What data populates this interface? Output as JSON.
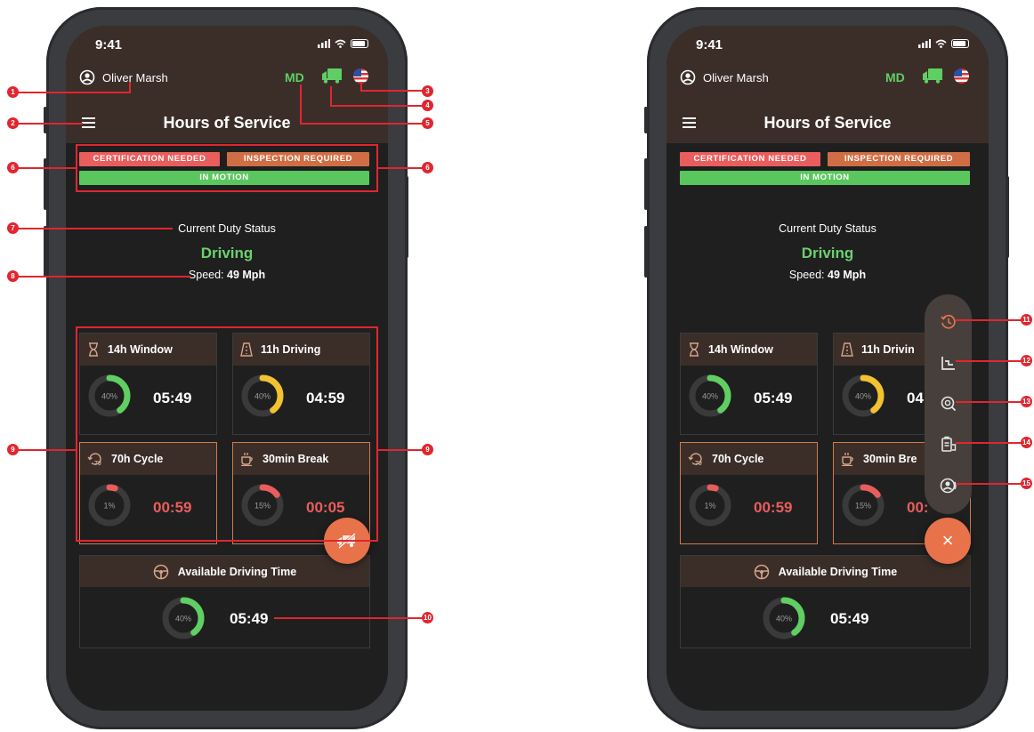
{
  "status_bar": {
    "time": "9:41"
  },
  "user": {
    "name": "Oliver Marsh"
  },
  "header": {
    "state": "MD",
    "title": "Hours of Service"
  },
  "badges": {
    "certification": "CERTIFICATION NEEDED",
    "inspection": "INSPECTION REQUIRED",
    "motion": "IN MOTION"
  },
  "duty": {
    "label": "Current Duty Status",
    "status": "Driving",
    "speed_label": "Speed:",
    "speed_value": "49 Mph"
  },
  "cards": [
    {
      "title": "14h Window",
      "percent_label": "40%",
      "percent": 40,
      "time": "05:49",
      "ring_color": "#5fcf64"
    },
    {
      "title": "11h Driving",
      "percent_label": "40%",
      "percent": 40,
      "time": "04:59",
      "ring_color": "#f2c230"
    },
    {
      "title": "70h Cycle",
      "percent_label": "1%",
      "percent": 1,
      "time": "00:59",
      "ring_color": "#ea5d5d"
    },
    {
      "title": "30min Break",
      "percent_label": "15%",
      "percent": 15,
      "time": "00:05",
      "ring_color": "#ea5d5d"
    }
  ],
  "available": {
    "title": "Available Driving Time",
    "percent_label": "40%",
    "percent": 40,
    "time": "05:49"
  },
  "right_cards": [
    {
      "title": "14h Window",
      "time": "05:49"
    },
    {
      "title": "11h Drivin",
      "time": "04"
    },
    {
      "title": "70h Cycle",
      "time": "00:59"
    },
    {
      "title": "30min Bre",
      "time": "00:"
    }
  ],
  "fab": {
    "close_label": "×"
  },
  "speed_dial": [
    {
      "icon": "history-icon"
    },
    {
      "icon": "graph-icon"
    },
    {
      "icon": "inspection-icon"
    },
    {
      "icon": "documents-icon"
    },
    {
      "icon": "driver-icon"
    }
  ],
  "callouts": [
    "1",
    "2",
    "3",
    "4",
    "5",
    "6",
    "6",
    "7",
    "8",
    "9",
    "9",
    "10",
    "11",
    "12",
    "13",
    "14",
    "15"
  ],
  "colors": {
    "accent": "#e8724a",
    "green": "#5fcf64",
    "red": "#ea5d5d",
    "header": "#3b2e29",
    "callout": "#e0262f"
  }
}
